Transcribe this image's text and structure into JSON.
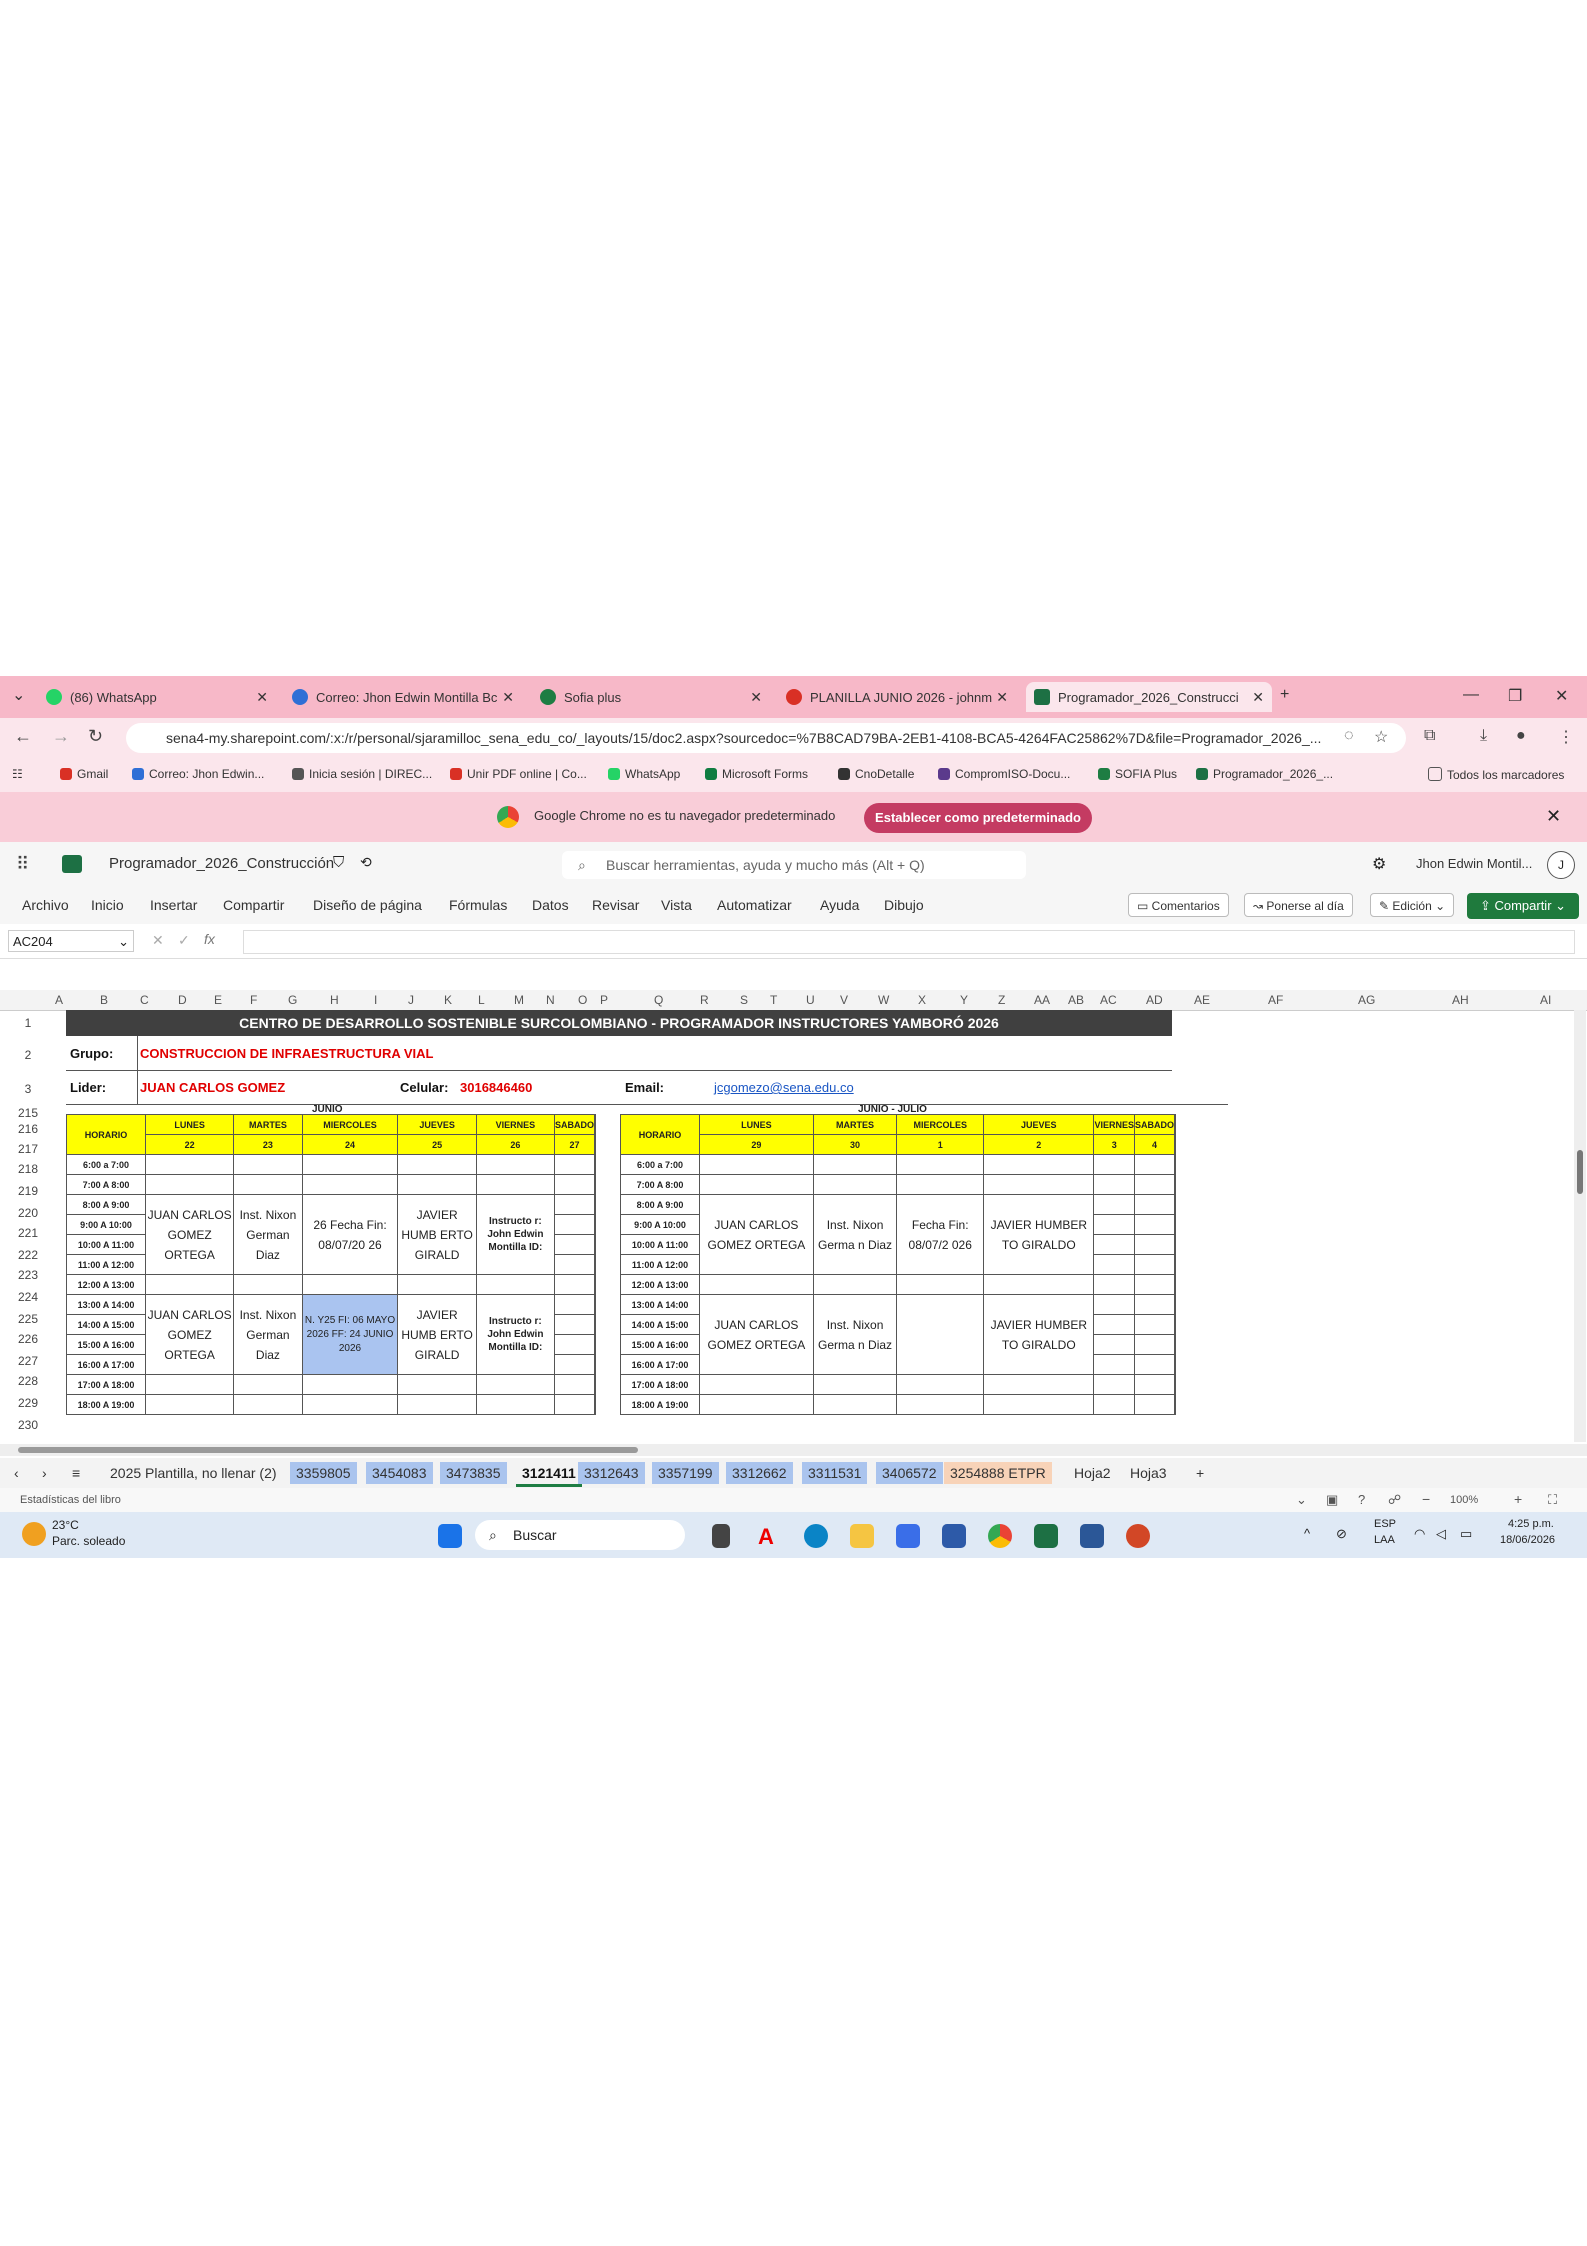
{
  "browser": {
    "tabs": [
      {
        "title": "(86) WhatsApp",
        "color": "#25d366"
      },
      {
        "title": "Correo: Jhon Edwin Montilla Bc",
        "color": "#2f6fd6"
      },
      {
        "title": "Sofia plus",
        "color": "#1e7d43"
      },
      {
        "title": "PLANILLA JUNIO 2026 - johnm",
        "color": "#d93025"
      },
      {
        "title": "Programador_2026_Construcci",
        "color": "#1d7044"
      }
    ],
    "url": "sena4-my.sharepoint.com/:x:/r/personal/sjaramilloc_sena_edu_co/_layouts/15/doc2.aspx?sourcedoc=%7B8CAD79BA-2EB1-4108-BCA5-4264FAC25862%7D&file=Programador_2026_...",
    "bookmarks": [
      "Gmail",
      "Correo: Jhon Edwin...",
      "Inicia sesión | DIREC...",
      "Unir PDF online | Co...",
      "WhatsApp",
      "Microsoft Forms",
      "CnoDetalle",
      "CompromISO-Docu...",
      "SOFIA Plus",
      "Programador_2026_...",
      "Todos los marcadores"
    ],
    "notification": {
      "text": "Google Chrome no es tu navegador predeterminado",
      "button": "Establecer como predeterminado"
    }
  },
  "excel": {
    "doc_title": "Programador_2026_Construcción",
    "search_placeholder": "Buscar herramientas, ayuda y mucho más (Alt + Q)",
    "user": "Jhon Edwin Montil...",
    "avatar": "J",
    "menu": [
      "Archivo",
      "Inicio",
      "Insertar",
      "Compartir",
      "Diseño de página",
      "Fórmulas",
      "Datos",
      "Revisar",
      "Vista",
      "Automatizar",
      "Ayuda",
      "Dibujo"
    ],
    "buttons": {
      "comments": "Comentarios",
      "catchup": "Ponerse al día",
      "edit": "Edición",
      "share": "Compartir"
    },
    "name_box": "AC204",
    "columns": [
      "A",
      "B",
      "C",
      "D",
      "E",
      "F",
      "G",
      "H",
      "I",
      "J",
      "K",
      "L",
      "M",
      "N",
      "O",
      "P",
      "Q",
      "R",
      "S",
      "T",
      "U",
      "V",
      "W",
      "X",
      "Y",
      "Z",
      "AA",
      "AB",
      "AC",
      "AD",
      "AE",
      "AF",
      "AG",
      "AH",
      "AI"
    ]
  },
  "sheet": {
    "title": "CENTRO DE DESARROLLO SOSTENIBLE SURCOLOMBIANO -  PROGRAMADOR INSTRUCTORES YAMBORÓ 2026",
    "group_label": "Grupo:",
    "group_value": "CONSTRUCCION DE INFRAESTRUCTURA VIAL",
    "leader_label": "Lider:",
    "leader_value": "JUAN CARLOS GOMEZ",
    "cell_label": "Celular:",
    "cell_value": "3016846460",
    "email_label": "Email:",
    "email_value": "jcgomezo@sena.edu.co",
    "row_numbers": [
      "1",
      "2",
      "3",
      "215",
      "216",
      "217",
      "218",
      "219",
      "220",
      "221",
      "222",
      "223",
      "224",
      "225",
      "226",
      "227",
      "228",
      "229",
      "230"
    ],
    "week1": {
      "month": "JUNIO",
      "horario": "HORARIO",
      "days": [
        "LUNES",
        "MARTES",
        "MIERCOLES",
        "JUEVES",
        "VIERNES",
        "SABADO"
      ],
      "dates": [
        "22",
        "23",
        "24",
        "25",
        "26",
        "27"
      ],
      "hours": [
        "6:00 a 7:00",
        "7:00 A 8:00",
        "8:00 A 9:00",
        "9:00 A 10:00",
        "10:00 A 11:00",
        "11:00 A 12:00",
        "12:00 A 13:00",
        "13:00 A 14:00",
        "14:00 A 15:00",
        "15:00 A 16:00",
        "16:00 A 17:00",
        "17:00 A 18:00",
        "18:00 A 19:00"
      ],
      "am": [
        "JUAN CARLOS GOMEZ ORTEGA",
        "Inst. Nixon German Diaz",
        "26 Fecha Fin: 08/07/20 26",
        "JAVIER HUMB ERTO GIRALD",
        "Instructo r: John Edwin Montilla ID:"
      ],
      "pm": [
        "JUAN CARLOS GOMEZ ORTEGA",
        "Inst. Nixon German Diaz",
        "N. Y25 FI: 06 MAYO 2026 FF: 24 JUNIO 2026",
        "JAVIER HUMB ERTO GIRALD",
        "Instructo r: John Edwin Montilla ID:"
      ]
    },
    "week2": {
      "month": "JUNIO - JULIO",
      "horario": "HORARIO",
      "days": [
        "LUNES",
        "MARTES",
        "MIERCOLES",
        "JUEVES",
        "VIERNES",
        "SABADO"
      ],
      "dates": [
        "29",
        "30",
        "1",
        "2",
        "3",
        "4"
      ],
      "hours": [
        "6:00 a 7:00",
        "7:00 A 8:00",
        "8:00 A 9:00",
        "9:00 A 10:00",
        "10:00 A 11:00",
        "11:00 A 12:00",
        "12:00 A 13:00",
        "13:00 A 14:00",
        "14:00 A 15:00",
        "15:00 A 16:00",
        "16:00 A 17:00",
        "17:00 A 18:00",
        "18:00 A 19:00"
      ],
      "am": [
        "JUAN CARLOS GOMEZ ORTEGA",
        "Inst. Nixon Germa n Diaz",
        "Fecha Fin: 08/07/2 026",
        "JAVIER HUMBER TO GIRALDO"
      ],
      "pm": [
        "JUAN CARLOS GOMEZ ORTEGA",
        "Inst. Nixon Germa n Diaz",
        "",
        "JAVIER HUMBER TO GIRALDO"
      ]
    }
  },
  "sheet_tabs": [
    "2025 Plantilla, no llenar (2)",
    "3359805",
    "3454083",
    "3473835",
    "3121411",
    "3312643",
    "3357199",
    "3312662",
    "3311531",
    "3406572",
    "3254888 ETPR",
    "Hoja2",
    "Hoja3"
  ],
  "status": {
    "left": "Estadísticas del libro",
    "zoom": "100%"
  },
  "taskbar": {
    "weather_temp": "23°C",
    "weather_desc": "Parc. soleado",
    "search": "Buscar",
    "lang1": "ESP",
    "lang2": "LAA",
    "time": "4:25 p.m.",
    "date": "18/06/2026"
  }
}
